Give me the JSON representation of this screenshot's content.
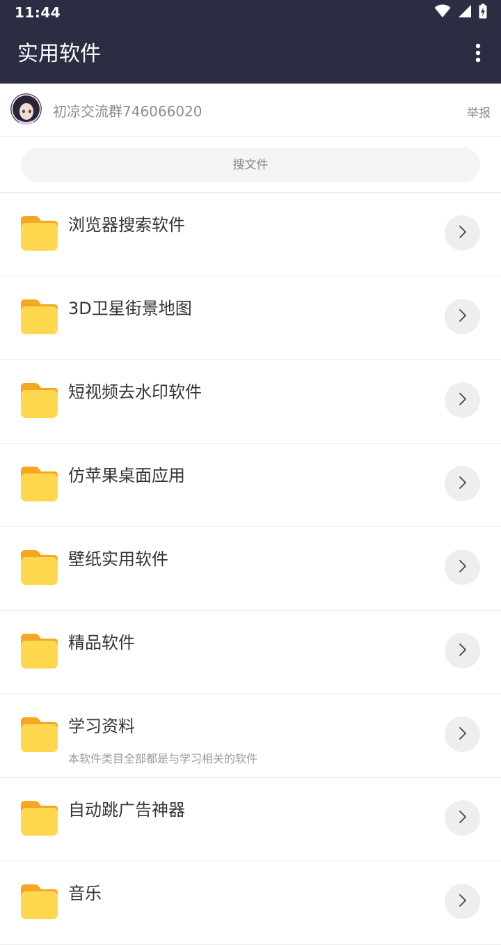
{
  "status_bar": {
    "time": "11:44",
    "icons": [
      "wifi-icon",
      "cell-signal-icon",
      "battery-charging-icon"
    ]
  },
  "app_bar": {
    "title": "实用软件",
    "menu_icon": "more-vert-icon"
  },
  "info_row": {
    "group_text": "初凉交流群746066020",
    "report_label": "举报"
  },
  "search": {
    "placeholder": "搜文件"
  },
  "folders": [
    {
      "title": "浏览器搜索软件",
      "subtitle": ""
    },
    {
      "title": "3D卫星街景地图",
      "subtitle": ""
    },
    {
      "title": "短视频去水印软件",
      "subtitle": ""
    },
    {
      "title": "仿苹果桌面应用",
      "subtitle": ""
    },
    {
      "title": "壁纸实用软件",
      "subtitle": ""
    },
    {
      "title": "精品软件",
      "subtitle": ""
    },
    {
      "title": "学习资料",
      "subtitle": "本软件类目全部都是与学习相关的软件"
    },
    {
      "title": "自动跳广告神器",
      "subtitle": ""
    },
    {
      "title": "音乐",
      "subtitle": ""
    }
  ],
  "colors": {
    "app_bar_bg": "#2b2d42",
    "folder_front": "#ffd84f",
    "folder_back": "#f5a623",
    "chevron_bg": "#eeeeee"
  }
}
